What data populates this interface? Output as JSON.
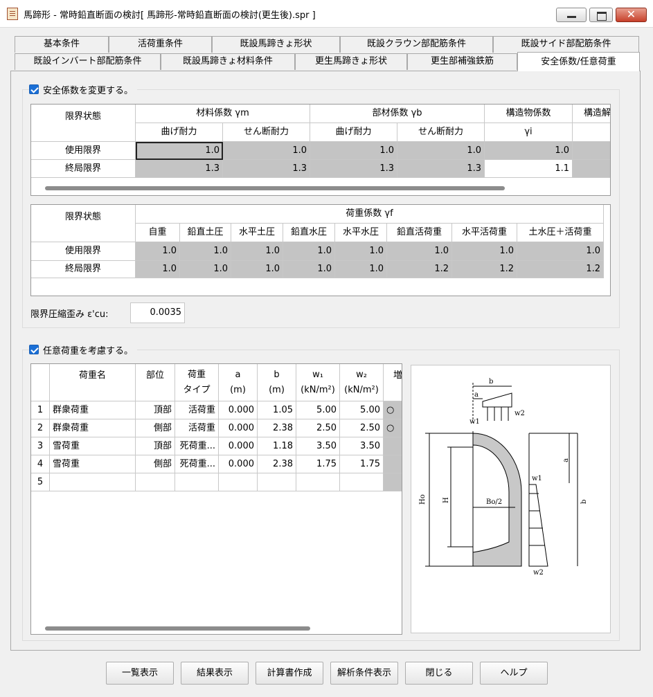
{
  "window": {
    "title": "馬蹄形 - 常時鉛直断面の検討[ 馬蹄形-常時鉛直断面の検討(更生後).spr ]",
    "close_glyph": "✕"
  },
  "tabs_row1": [
    "基本条件",
    "活荷重条件",
    "既設馬蹄きょ形状",
    "既設クラウン部配筋条件",
    "既設サイド部配筋条件"
  ],
  "tabs_row2": [
    "既設インバート部配筋条件",
    "既設馬蹄きょ材料条件",
    "更生馬蹄きょ形状",
    "更生部補強鉄筋",
    "安全係数/任意荷重"
  ],
  "safety": {
    "checkbox_label": "安全係数を変更する。",
    "table1": {
      "h_state": "限界状態",
      "h_material": "材料係数 γm",
      "h_member": "部材係数 γb",
      "h_structure": "構造物係数",
      "h_structure_sub": "γi",
      "h_structure2": "構造解",
      "h_bend1": "曲げ耐力",
      "h_shear1": "せん断耐力",
      "h_bend2": "曲げ耐力",
      "h_shear2": "せん断耐力",
      "rows": [
        {
          "label": "使用限界",
          "values": [
            "1.0",
            "1.0",
            "1.0",
            "1.0",
            "1.0"
          ]
        },
        {
          "label": "終局限界",
          "values": [
            "1.3",
            "1.3",
            "1.3",
            "1.3",
            "1.1"
          ]
        }
      ]
    },
    "table2": {
      "h_state": "限界状態",
      "h_load": "荷重係数 γf",
      "cols": [
        "自重",
        "鉛直土圧",
        "水平土圧",
        "鉛直水圧",
        "水平水圧",
        "鉛直活荷重",
        "水平活荷重",
        "土水圧＋活荷重"
      ],
      "rows": [
        {
          "label": "使用限界",
          "values": [
            "1.0",
            "1.0",
            "1.0",
            "1.0",
            "1.0",
            "1.0",
            "1.0",
            "1.0"
          ]
        },
        {
          "label": "終局限界",
          "values": [
            "1.0",
            "1.0",
            "1.0",
            "1.0",
            "1.0",
            "1.2",
            "1.2",
            "1.2"
          ]
        }
      ]
    },
    "strain_label": "限界圧縮歪み ε'cu:",
    "strain_value": "0.0035"
  },
  "loads": {
    "checkbox_label": "任意荷重を考慮する。",
    "headers": {
      "name": "荷重名",
      "part": "部位",
      "type1": "荷重",
      "type2": "タイプ",
      "a1": "a",
      "a2": "(m)",
      "b1": "b",
      "b2": "(m)",
      "w1": "w₁",
      "w1u": "(kN/m²)",
      "w2": "w₂",
      "w2u": "(kN/m²)",
      "inc": "増"
    },
    "rows": [
      {
        "no": "1",
        "name": "群衆荷重",
        "part": "頂部",
        "type": "活荷重",
        "a": "0.000",
        "b": "1.05",
        "w1": "5.00",
        "w2": "5.00",
        "inc": "○"
      },
      {
        "no": "2",
        "name": "群衆荷重",
        "part": "側部",
        "type": "活荷重",
        "a": "0.000",
        "b": "2.38",
        "w1": "2.50",
        "w2": "2.50",
        "inc": "○"
      },
      {
        "no": "3",
        "name": "雪荷重",
        "part": "頂部",
        "type": "死荷重...",
        "a": "0.000",
        "b": "1.18",
        "w1": "3.50",
        "w2": "3.50",
        "inc": ""
      },
      {
        "no": "4",
        "name": "雪荷重",
        "part": "側部",
        "type": "死荷重...",
        "a": "0.000",
        "b": "2.38",
        "w1": "1.75",
        "w2": "1.75",
        "inc": ""
      },
      {
        "no": "5",
        "name": "",
        "part": "",
        "type": "",
        "a": "",
        "b": "",
        "w1": "",
        "w2": "",
        "inc": ""
      }
    ]
  },
  "diagram": {
    "top_b": "b",
    "top_a": "a",
    "top_w1": "w1",
    "top_w2": "w2",
    "ho": "Ho",
    "h": "H",
    "bo2": "Bo/2",
    "side_a": "a",
    "side_b": "b",
    "side_w1": "w1",
    "side_w2": "w2"
  },
  "buttons": [
    "一覧表示",
    "結果表示",
    "計算書作成",
    "解析条件表示",
    "閉じる",
    "ヘルプ"
  ]
}
